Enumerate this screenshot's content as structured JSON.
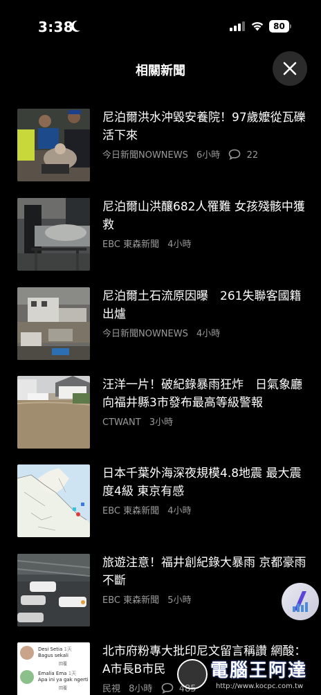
{
  "status_bar": {
    "time": "3:38",
    "battery": "80"
  },
  "header": {
    "title": "相關新聞"
  },
  "articles": [
    {
      "title": "尼泊爾洪水沖毀安養院！97歲嬤從瓦礫活下來",
      "source": "今日新聞NOWNEWS",
      "time": "6小時",
      "comments": "22"
    },
    {
      "title": "尼泊爾山洪釀682人罹難 女孩殘骸中獲救",
      "source": "EBC 東森新聞",
      "time": "4小時"
    },
    {
      "title": "尼泊爾土石流原因曝　261失聯客國籍出爐",
      "source": "今日新聞NOWNEWS",
      "time": "4小時"
    },
    {
      "title": "汪洋一片！破紀錄暴雨狂炸　日氣象廳向福井縣3市發布最高等級警報",
      "source": "CTWANT",
      "time": "3小時"
    },
    {
      "title": "日本千葉外海深夜規模4.8地震 最大震度4級 東京有感",
      "source": "EBC 東森新聞",
      "time": "4小時"
    },
    {
      "title": "旅遊注意！福井創紀錄大暴雨 京都豪雨不斷",
      "source": "EBC 東森新聞",
      "time": "5小時"
    },
    {
      "title": "北市府粉專大批印尼文留言稱讚 網酸：A市長B市民",
      "source": "民視",
      "time": "8小時",
      "comments": "485"
    }
  ],
  "thumb7": {
    "c1_name": "Desi Setia",
    "c1_time": "1天",
    "c1_text": "Bagus sekali",
    "c2_name": "Emalia Ema",
    "c2_time": "1天",
    "c2_text": "Apa ini ya gak ngerti",
    "reply": "回覆"
  },
  "watermark": {
    "text": "電腦王阿達",
    "url": "http://www.kocpc.com.tw"
  }
}
